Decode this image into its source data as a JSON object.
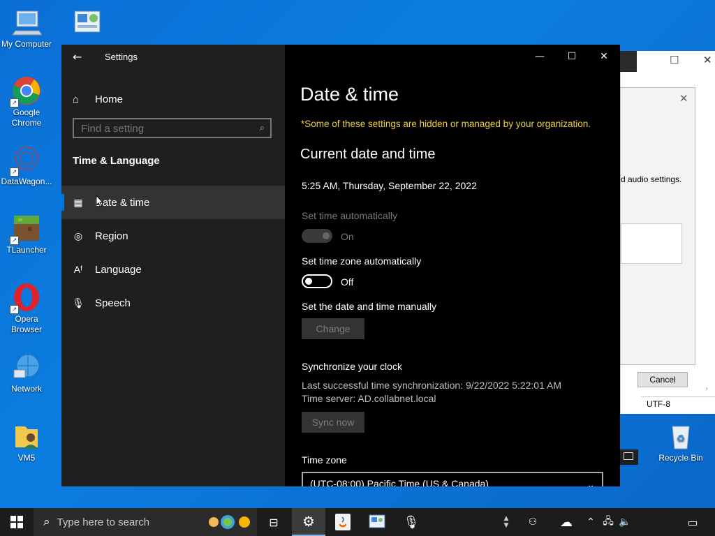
{
  "desktop": {
    "icons": [
      {
        "label": "My Computer"
      },
      {
        "label": "Control Panel"
      },
      {
        "label": "Google Chrome"
      },
      {
        "label": "DataWagon..."
      },
      {
        "label": "TLauncher"
      },
      {
        "label": "Opera Browser"
      },
      {
        "label": "Network"
      },
      {
        "label": "VM5"
      },
      {
        "label": "Recycle Bin"
      }
    ]
  },
  "background_windows": {
    "audio_text": "d audio settings.",
    "cancel_label": "Cancel",
    "encoding": "UTF-8"
  },
  "settings": {
    "window_title": "Settings",
    "sidebar": {
      "home_label": "Home",
      "search_placeholder": "Find a setting",
      "section_title": "Time & Language",
      "items": [
        {
          "label": "Date & time",
          "icon": "calendar-clock-icon"
        },
        {
          "label": "Region",
          "icon": "globe-icon"
        },
        {
          "label": "Language",
          "icon": "language-icon"
        },
        {
          "label": "Speech",
          "icon": "microphone-icon"
        }
      ]
    },
    "content": {
      "title": "Date & time",
      "warning": "*Some of these settings are hidden or managed by your organization.",
      "current_heading": "Current date and time",
      "current_value": "5:25 AM, Thursday, September 22, 2022",
      "set_auto_label": "Set time automatically",
      "set_auto_state": "On",
      "set_tz_auto_label": "Set time zone automatically",
      "set_tz_auto_state": "Off",
      "manual_label": "Set the date and time manually",
      "change_button": "Change",
      "sync_heading": "Synchronize your clock",
      "sync_last": "Last successful time synchronization: 9/22/2022 5:22:01 AM",
      "sync_server": "Time server: AD.collabnet.local",
      "sync_button": "Sync now",
      "timezone_label": "Time zone",
      "timezone_value": "(UTC-08:00) Pacific Time (US & Canada)"
    }
  },
  "taskbar": {
    "search_placeholder": "Type here to search"
  },
  "colors": {
    "accent": "#0078d4",
    "warning": "#f0d13a",
    "desktop": "#0b78dc"
  }
}
